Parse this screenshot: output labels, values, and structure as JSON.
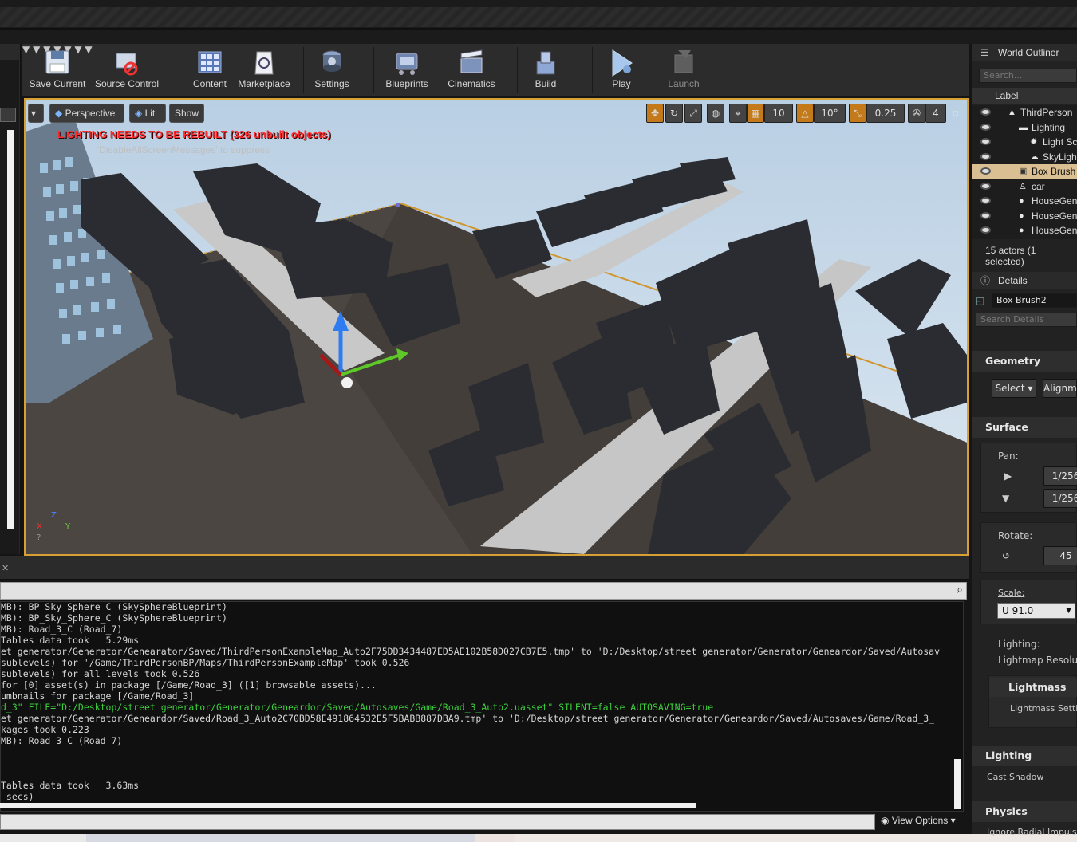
{
  "toolbar": {
    "buttons": [
      {
        "label": "Save Current",
        "icon": "save-icon"
      },
      {
        "label": "Source Control",
        "icon": "source-control-icon"
      },
      {
        "label": "Content",
        "icon": "content-icon"
      },
      {
        "label": "Marketplace",
        "icon": "marketplace-icon"
      },
      {
        "label": "Settings",
        "icon": "settings-icon"
      },
      {
        "label": "Blueprints",
        "icon": "blueprints-icon"
      },
      {
        "label": "Cinematics",
        "icon": "cinematics-icon"
      },
      {
        "label": "Build",
        "icon": "build-icon"
      },
      {
        "label": "Play",
        "icon": "play-icon"
      },
      {
        "label": "Launch",
        "icon": "launch-icon"
      }
    ]
  },
  "viewport": {
    "perspective": "Perspective",
    "lit": "Lit",
    "show": "Show",
    "grid_snap": "10",
    "rotation_snap": "10°",
    "scale_snap": "0.25",
    "camera_speed": "4",
    "warning": "LIGHTING NEEDS TO BE REBUILT (326 unbuilt objects)",
    "suppress": "'DisableAllScreenMessages' to suppress",
    "axis_x": "X",
    "axis_y": "Y",
    "axis_z": "Z"
  },
  "console": {
    "lines": [
      {
        "text": "MB): BP_Sky_Sphere_C (SkySphereBlueprint)",
        "green": false
      },
      {
        "text": "MB): BP_Sky_Sphere_C (SkySphereBlueprint)",
        "green": false
      },
      {
        "text": "MB): Road_3_C (Road_7)",
        "green": false
      },
      {
        "text": "Tables data took   5.29ms",
        "green": false
      },
      {
        "text": "et generator/Generator/Genearator/Saved/ThirdPersonExampleMap_Auto2F75DD3434487ED5AE102B58D027CB7E5.tmp' to 'D:/Desktop/street generator/Generator/Geneardor/Saved/Autosav",
        "green": false
      },
      {
        "text": "sublevels) for '/Game/ThirdPersonBP/Maps/ThirdPersonExampleMap' took 0.526",
        "green": false
      },
      {
        "text": "sublevels) for all levels took 0.526",
        "green": false
      },
      {
        "text": "for [0] asset(s) in package [/Game/Road_3] ([1] browsable assets)...",
        "green": false
      },
      {
        "text": "umbnails for package [/Game/Road_3]",
        "green": false
      },
      {
        "text": "d_3\" FILE=\"D:/Desktop/street generator/Generator/Geneardor/Saved/Autosaves/Game/Road_3_Auto2.uasset\" SILENT=false AUTOSAVING=true",
        "green": true
      },
      {
        "text": "et generator/Generator/Geneardor/Saved/Road_3_Auto2C70BD58E491864532E5F5BABB887DBA9.tmp' to 'D:/Desktop/street generator/Generator/Geneardor/Saved/Autosaves/Game/Road_3_",
        "green": false
      },
      {
        "text": "kages took 0.223",
        "green": false
      },
      {
        "text": "MB): Road_3_C (Road_7)",
        "green": false
      },
      {
        "text": "",
        "green": false
      },
      {
        "text": "",
        "green": false
      },
      {
        "text": "",
        "green": false
      },
      {
        "text": "Tables data took   3.63ms",
        "green": false
      },
      {
        "text": " secs)",
        "green": false
      }
    ],
    "view_options": "View Options"
  },
  "outliner": {
    "title": "World Outliner",
    "search_placeholder": "Search...",
    "column_label": "Label",
    "items": [
      {
        "label": "ThirdPerson",
        "indent": 1,
        "selected": false,
        "icon": "level-icon"
      },
      {
        "label": "Lighting",
        "indent": 2,
        "selected": false,
        "icon": "folder-icon"
      },
      {
        "label": "Light Sc",
        "indent": 3,
        "selected": false,
        "icon": "light-icon"
      },
      {
        "label": "SkyLigh",
        "indent": 3,
        "selected": false,
        "icon": "skylight-icon"
      },
      {
        "label": "Box Brush",
        "indent": 2,
        "selected": true,
        "icon": "brush-icon"
      },
      {
        "label": "car",
        "indent": 2,
        "selected": false,
        "icon": "actor-icon"
      },
      {
        "label": "HouseGen",
        "indent": 2,
        "selected": false,
        "icon": "sphere-icon"
      },
      {
        "label": "HouseGen",
        "indent": 2,
        "selected": false,
        "icon": "sphere-icon"
      },
      {
        "label": "HouseGen",
        "indent": 2,
        "selected": false,
        "icon": "sphere-icon"
      }
    ],
    "count": "15 actors (1 selected)"
  },
  "details": {
    "title": "Details",
    "name": "Box Brush2",
    "search_placeholder": "Search Details",
    "geometry": "Geometry",
    "select": "Select",
    "alignment": "Alignme",
    "surface_properties": "Surface Properties",
    "pan": "Pan:",
    "pan_u": "1/256",
    "pan_v": "1/256",
    "rotate": "Rotate:",
    "rotate_value": "45",
    "scale": "Scale:",
    "scale_value": "U  91.0",
    "lighting_label": "Lighting:",
    "lightmap_res": "Lightmap Resoluti",
    "lightmass": "Lightmass",
    "lightmass_settings": "Lightmass Settir",
    "lighting_section": "Lighting",
    "cast_shadow": "Cast Shadow",
    "physics": "Physics",
    "ignore_radial": "Ignore Radial Impulse"
  }
}
